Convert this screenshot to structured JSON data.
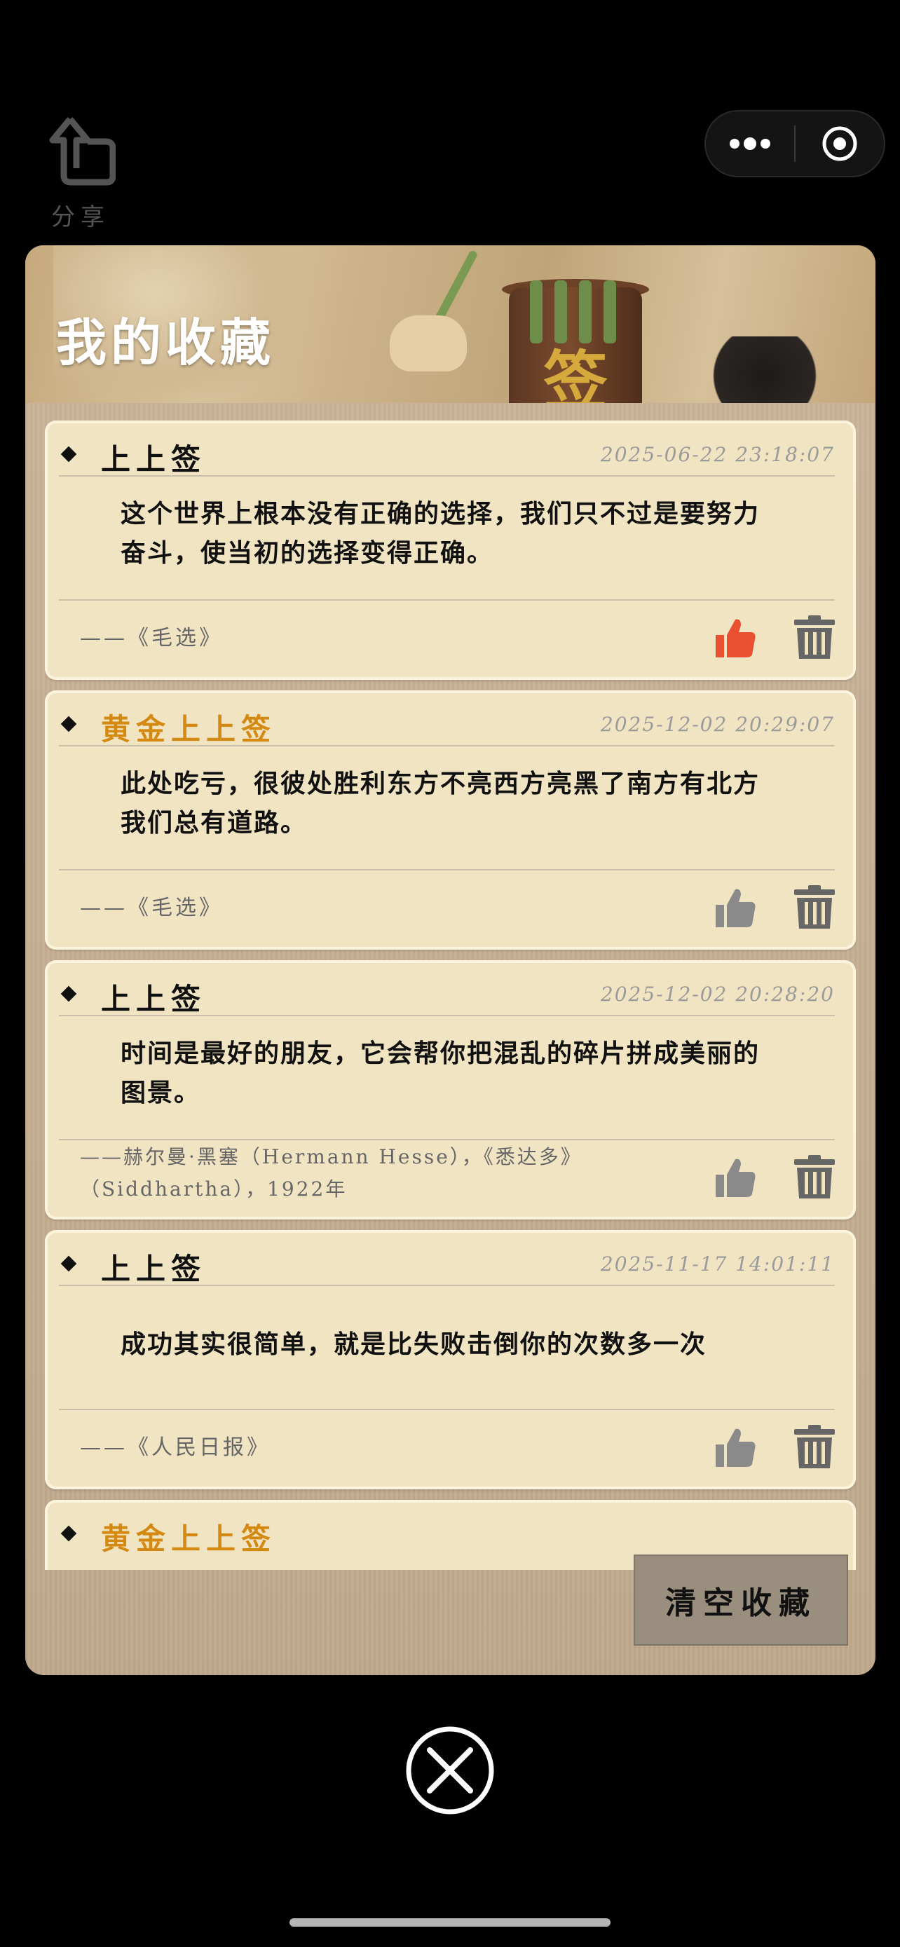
{
  "background": {
    "share_label": "分享"
  },
  "modal": {
    "title": "我的收藏",
    "banner_char": "签",
    "clear_button": "清空收藏",
    "items": [
      {
        "level": "上上签",
        "is_gold": false,
        "date": "2025-06-22 23:18:07",
        "quote": "这个世界上根本没有正确的选择，我们只不过是要努力奋斗，使当初的选择变得正确。",
        "source": "——《毛选》",
        "liked": true
      },
      {
        "level": "黄金上上签",
        "is_gold": true,
        "date": "2025-12-02 20:29:07",
        "quote": "此处吃亏，很彼处胜利东方不亮西方亮黑了南方有北方我们总有道路。",
        "source": "——《毛选》",
        "liked": false
      },
      {
        "level": "上上签",
        "is_gold": false,
        "date": "2025-12-02 20:28:20",
        "quote": "时间是最好的朋友，它会帮你把混乱的碎片拼成美丽的图景。",
        "source": "——赫尔曼·黑塞（Hermann Hesse），《悉达多》（Siddhartha），1922年",
        "liked": false
      },
      {
        "level": "上上签",
        "is_gold": false,
        "date": "2025-11-17 14:01:11",
        "quote": "成功其实很简单，就是比失败击倒你的次数多一次",
        "source": "——《人民日报》",
        "liked": false
      },
      {
        "level": "黄金上上签",
        "is_gold": true,
        "date": "",
        "quote": "",
        "source": "",
        "liked": false
      }
    ]
  },
  "colors": {
    "liked": "#e8502f",
    "unliked": "#8a8a8a",
    "gold_level": "#d48a12",
    "card": "#f0e4c3"
  },
  "icons": {
    "like": "thumbs-up-icon",
    "delete": "trash-icon",
    "close": "close-circle-icon",
    "share": "share-icon",
    "more": "more-dots-icon",
    "target": "target-icon"
  }
}
